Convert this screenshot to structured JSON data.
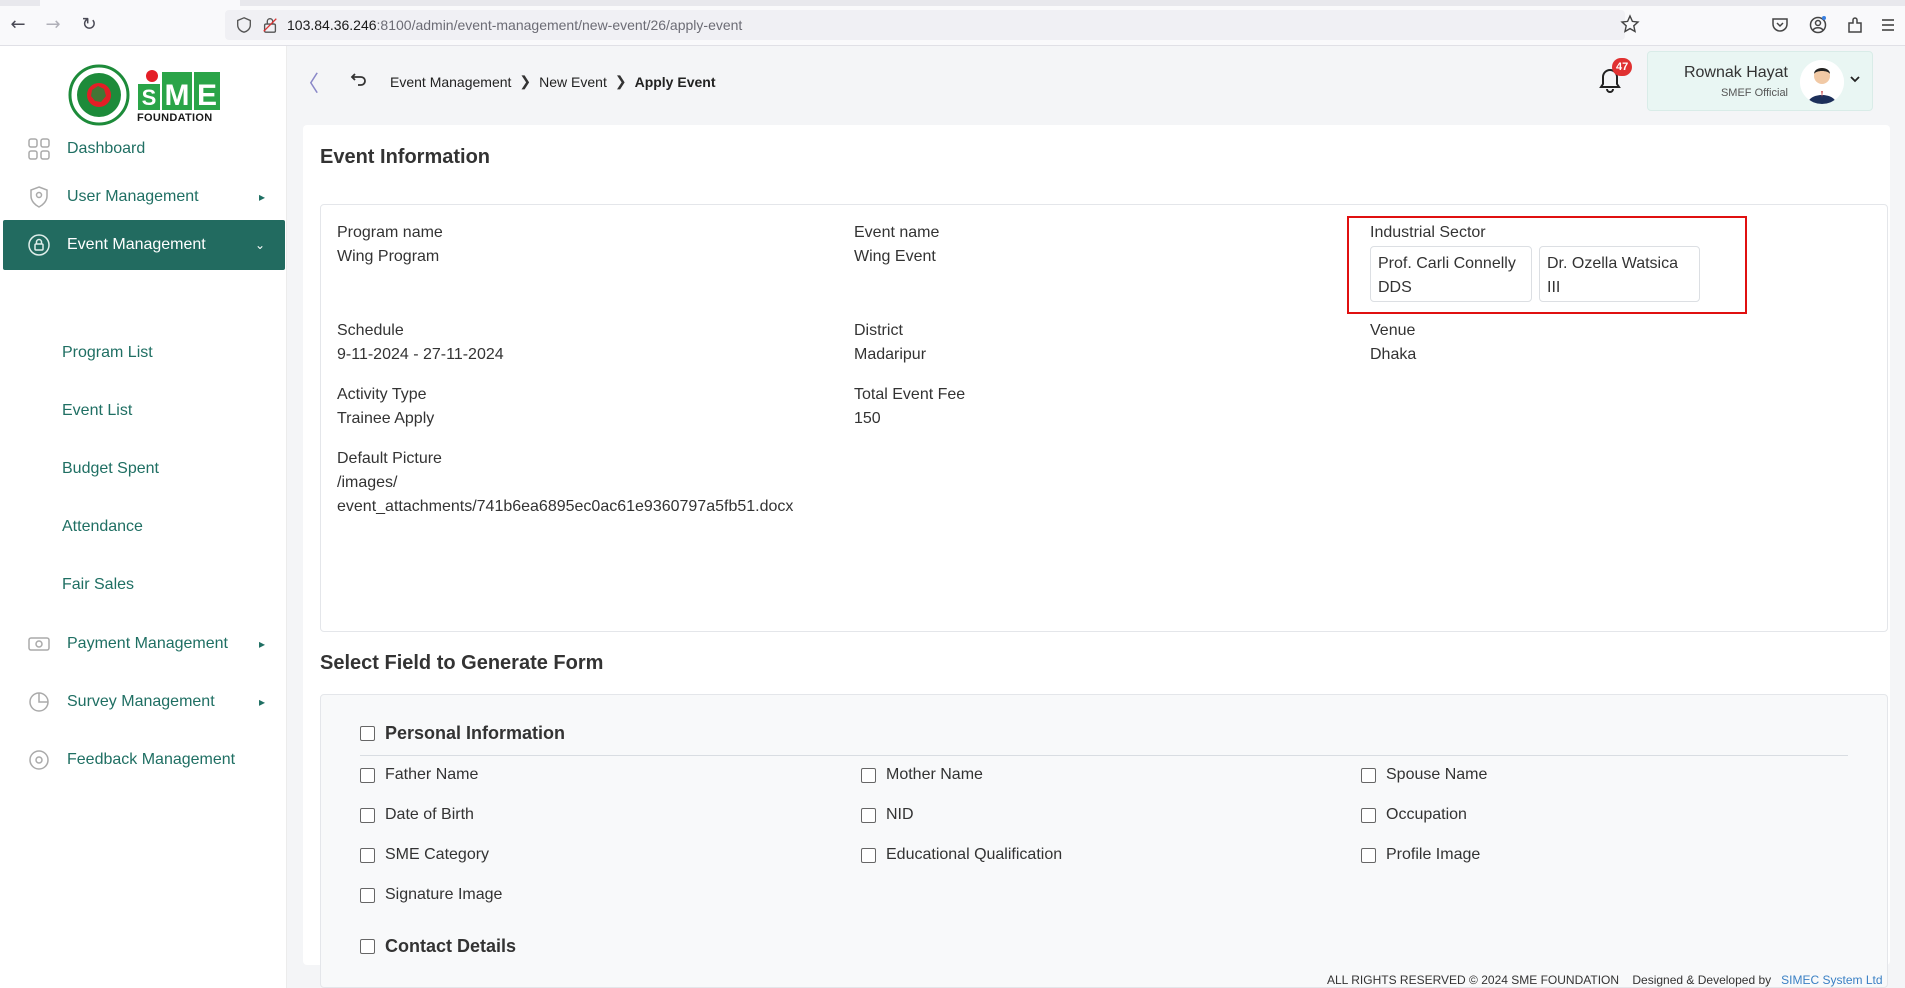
{
  "browser": {
    "url_host": "103.84.36.246",
    "url_rest": ":8100/admin/event-management/new-event/26/apply-event"
  },
  "logo": {
    "sme_text": "SME",
    "foundation_text": "FOUNDATION"
  },
  "sidebar": {
    "items": [
      {
        "label": "Dashboard",
        "icon": "grid-icon",
        "has_caret": false
      },
      {
        "label": "User Management",
        "icon": "user-shield-icon",
        "has_caret": true
      },
      {
        "label": "Event Management",
        "icon": "lock-circle-icon",
        "has_caret": true,
        "active": true
      },
      {
        "label": "Payment Management",
        "icon": "money-icon",
        "has_caret": true
      },
      {
        "label": "Survey Management",
        "icon": "pie-chart-icon",
        "has_caret": true
      },
      {
        "label": "Feedback Management",
        "icon": "feedback-icon",
        "has_caret": false
      }
    ],
    "sub_items": [
      "Program List",
      "Event List",
      "Budget Spent",
      "Attendance",
      "Fair Sales"
    ]
  },
  "breadcrumb": {
    "items": [
      "Event Management",
      "New Event",
      "Apply Event"
    ]
  },
  "notifications": {
    "count": "47"
  },
  "user": {
    "name": "Rownak Hayat",
    "role": "SMEF Official"
  },
  "event_info": {
    "title": "Event Information",
    "program_name": {
      "label": "Program name",
      "value": "Wing Program"
    },
    "event_name": {
      "label": "Event name",
      "value": "Wing Event"
    },
    "industrial_sector": {
      "label": "Industrial Sector",
      "tags": [
        {
          "line1": "Prof. Carli Connelly",
          "line2": "DDS"
        },
        {
          "line1": "Dr. Ozella Watsica",
          "line2": "III"
        }
      ]
    },
    "schedule": {
      "label": "Schedule",
      "value": "9-11-2024 - 27-11-2024"
    },
    "district": {
      "label": "District",
      "value": "Madaripur"
    },
    "venue": {
      "label": "Venue",
      "value": "Dhaka"
    },
    "activity_type": {
      "label": "Activity Type",
      "value": "Trainee Apply"
    },
    "total_event_fee": {
      "label": "Total Event Fee",
      "value": "150"
    },
    "default_picture": {
      "label": "Default Picture",
      "value_line1": "/images/",
      "value_line2": "event_attachments/741b6ea6895ec0ac61e9360797a5fb51.docx"
    }
  },
  "form_fields": {
    "title": "Select Field to Generate Form",
    "personal_group": "Personal Information",
    "personal_fields": [
      "Father Name",
      "Mother Name",
      "Spouse Name",
      "Date of Birth",
      "NID",
      "Occupation",
      "SME Category",
      "Educational Qualification",
      "Profile Image",
      "Signature Image"
    ],
    "contact_group": "Contact Details"
  },
  "footer": {
    "rights": "ALL RIGHTS RESERVED © 2024 SME FOUNDATION",
    "designed": "Designed & Developed by",
    "company": "SIMEC System Ltd"
  }
}
